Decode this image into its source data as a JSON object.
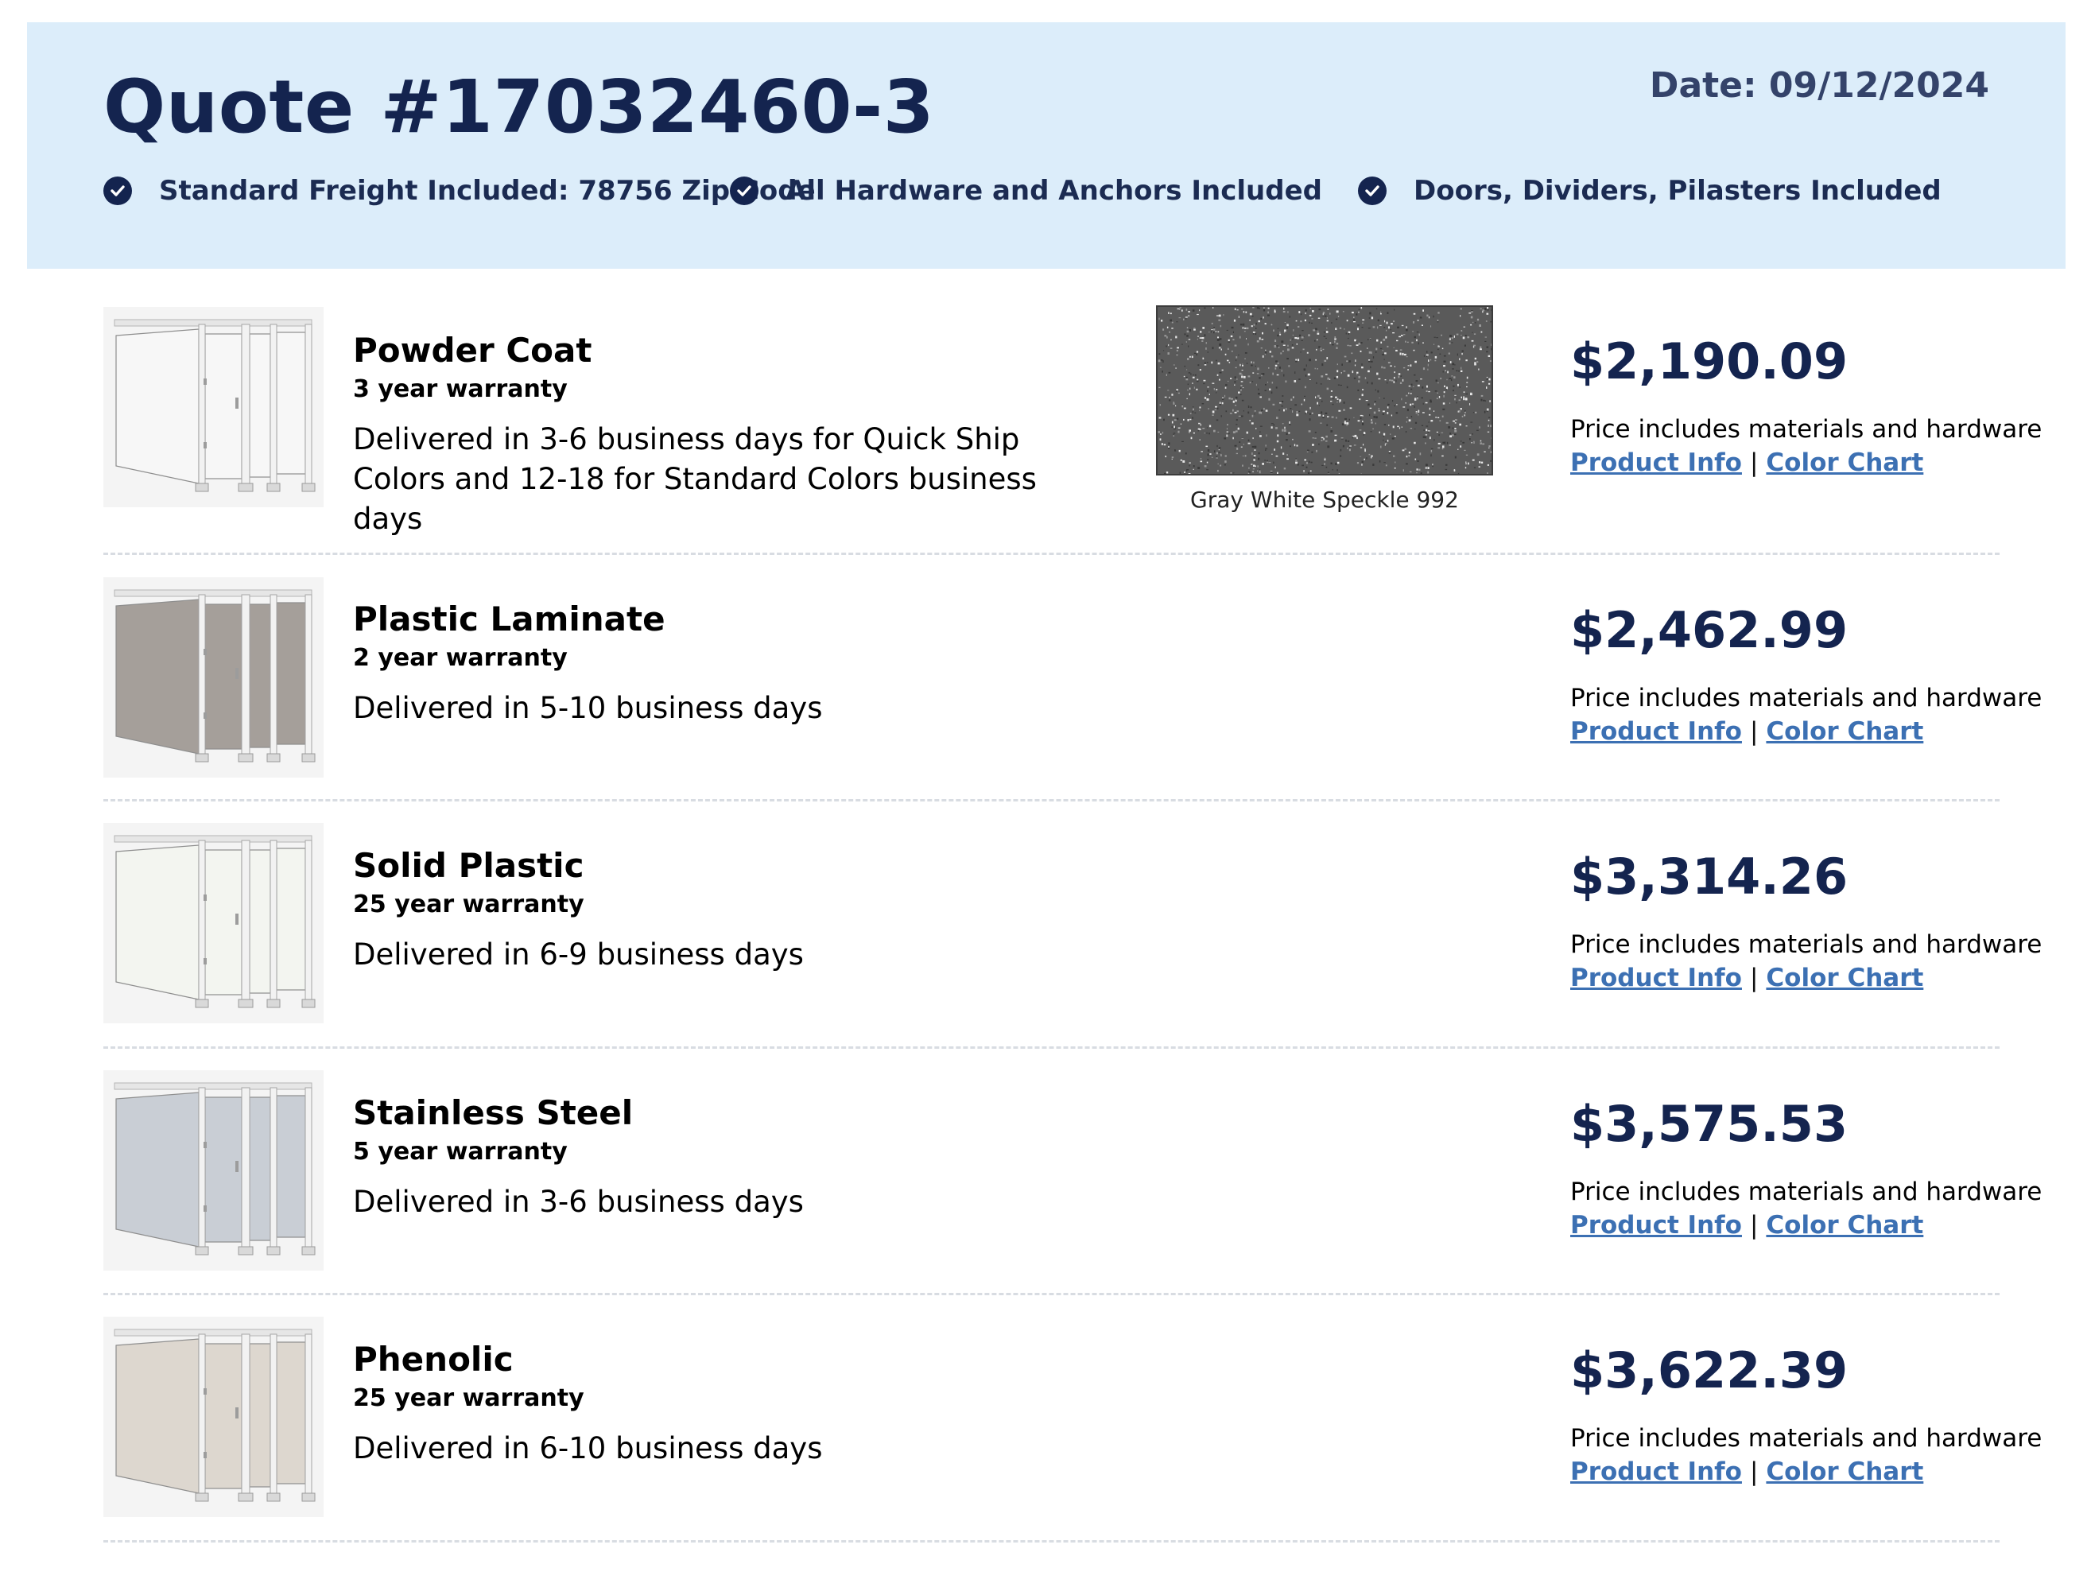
{
  "header": {
    "quote_title": "Quote #17032460-3",
    "date": "Date: 09/12/2024",
    "features": [
      "Standard Freight Included: 78756 Zip Code",
      "All Hardware and Anchors Included",
      "Doors, Dividers, Pilasters Included"
    ]
  },
  "products": [
    {
      "name": "Powder Coat",
      "warranty": "3 year warranty",
      "delivery": "Delivered in 3-6 business days for Quick Ship Colors and 12-18 for Standard Colors business days",
      "swatch_label": "Gray White Speckle 992",
      "price": "$2,190.09",
      "price_note": "Price includes materials and hardware",
      "product_info_label": "Product Info",
      "color_chart_label": "Color Chart",
      "separator": "|",
      "panel_color": "#f7f7f7"
    },
    {
      "name": "Plastic Laminate",
      "warranty": "2 year warranty",
      "delivery": "Delivered in 5-10 business days",
      "price": "$2,462.99",
      "price_note": "Price includes materials and hardware",
      "product_info_label": "Product Info",
      "color_chart_label": "Color Chart",
      "separator": "|",
      "panel_color": "#a59f9a"
    },
    {
      "name": "Solid Plastic",
      "warranty": "25 year warranty",
      "delivery": "Delivered in 6-9 business days",
      "price": "$3,314.26",
      "price_note": "Price includes materials and hardware",
      "product_info_label": "Product Info",
      "color_chart_label": "Color Chart",
      "separator": "|",
      "panel_color": "#f3f5f0"
    },
    {
      "name": "Stainless Steel",
      "warranty": "5 year warranty",
      "delivery": "Delivered in 3-6 business days",
      "price": "$3,575.53",
      "price_note": "Price includes materials and hardware",
      "product_info_label": "Product Info",
      "color_chart_label": "Color Chart",
      "separator": "|",
      "panel_color": "#c9ced5"
    },
    {
      "name": "Phenolic",
      "warranty": "25 year warranty",
      "delivery": "Delivered in 6-10 business days",
      "price": "$3,622.39",
      "price_note": "Price includes materials and hardware",
      "product_info_label": "Product Info",
      "color_chart_label": "Color Chart",
      "separator": "|",
      "panel_color": "#ddd7cf"
    }
  ],
  "colors": {
    "header_bg": "#dcedfa",
    "navy": "#14244f",
    "link": "#3c70b3",
    "swatch": "#5a5a5a"
  }
}
